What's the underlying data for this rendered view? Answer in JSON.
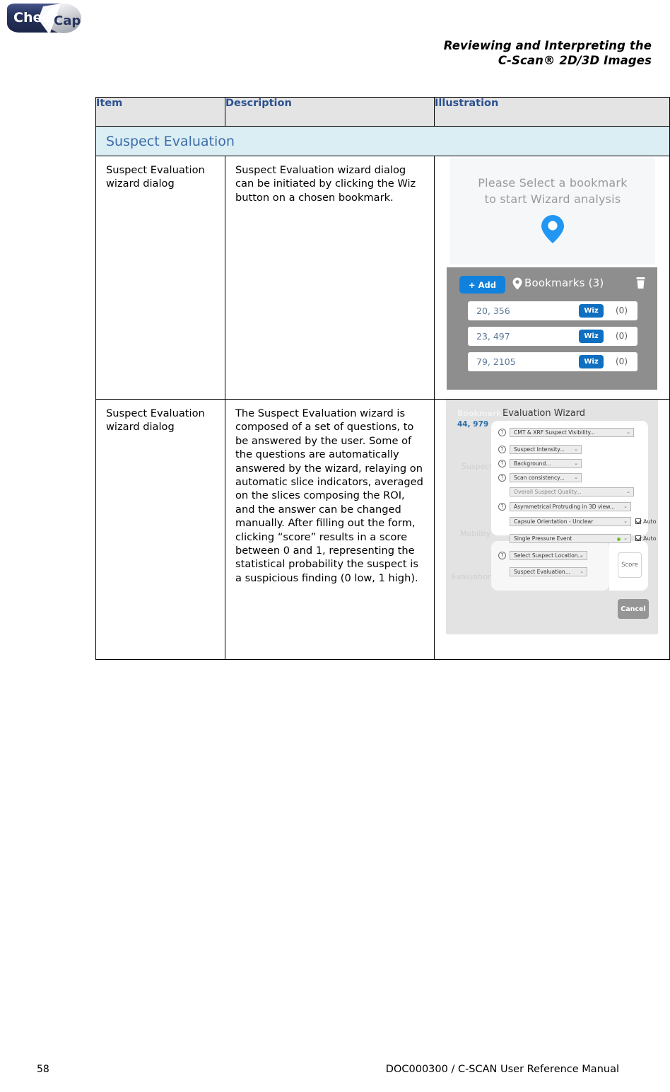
{
  "header": {
    "logo_text_1": "Check",
    "logo_text_2": "Cap",
    "title_line1": "Reviewing and Interpreting the",
    "title_line2": "C-Scan® 2D/3D Images"
  },
  "table": {
    "columns": [
      "Item",
      "Description",
      "Illustration"
    ],
    "section_title": "Suspect Evaluation",
    "rows": [
      {
        "item": "Suspect Evaluation wizard dialog",
        "description": "Suspect Evaluation wizard dialog can be initiated by clicking the Wiz button on a chosen bookmark."
      },
      {
        "item": "Suspect Evaluation wizard dialog",
        "description": "The Suspect Evaluation wizard is composed of a set of questions, to be answered by the user. Some of the questions are automatically answered by the wizard, relaying on automatic slice indicators, averaged on the slices composing the ROI, and the answer can be changed manually. After filling out the form, clicking “score” results in a score between 0 and 1, representing the statistical probability the suspect is a suspicious finding (0 low, 1 high)."
      }
    ]
  },
  "illustration_bookmarks": {
    "empty_line1": "Please Select a bookmark",
    "empty_line2": "to start Wizard analysis",
    "add_button": "+ Add",
    "panel_title": "Bookmarks (3)",
    "items": [
      {
        "coords": "20, 356",
        "wiz_label": "Wiz",
        "count": "(0)"
      },
      {
        "coords": "23, 497",
        "wiz_label": "Wiz",
        "count": "(0)"
      },
      {
        "coords": "79, 2105",
        "wiz_label": "Wiz",
        "count": "(0)"
      }
    ]
  },
  "illustration_wizard": {
    "bookmark_label": "Bookmark",
    "bookmark_coords": "44, 979",
    "title": "Evaluation Wizard",
    "stage_suspect": "Suspect",
    "stage_mobility": "Mobility",
    "stage_evaluation": "Evaluation",
    "fields": [
      {
        "label": "CMT & XRF Suspect Visibility..."
      },
      {
        "label": "Suspect Intensity..."
      },
      {
        "label": "Background..."
      },
      {
        "label": "Scan consistency..."
      },
      {
        "label": "Overall Suspect Quality..."
      },
      {
        "label": "Asymmetrical Protruding in 3D view..."
      },
      {
        "label": "Capsule Orientation - Unclear"
      },
      {
        "label": "Single Pressure Event"
      },
      {
        "label": "Select Suspect Location..."
      },
      {
        "label": "Suspect Evaluation..."
      }
    ],
    "auto_label": "Auto",
    "score_button": "Score",
    "cancel_button": "Cancel"
  },
  "footer": {
    "page_number": "58",
    "doc_reference": "DOC000300 / C-SCAN User Reference Manual"
  },
  "colors": {
    "header_blue": "#2b5190",
    "section_bg": "#daeef3",
    "section_text": "#3f6caa",
    "accent_blue": "#1081dc",
    "panel_gray": "#8e8e8e",
    "logo_navy": "#24325f"
  }
}
